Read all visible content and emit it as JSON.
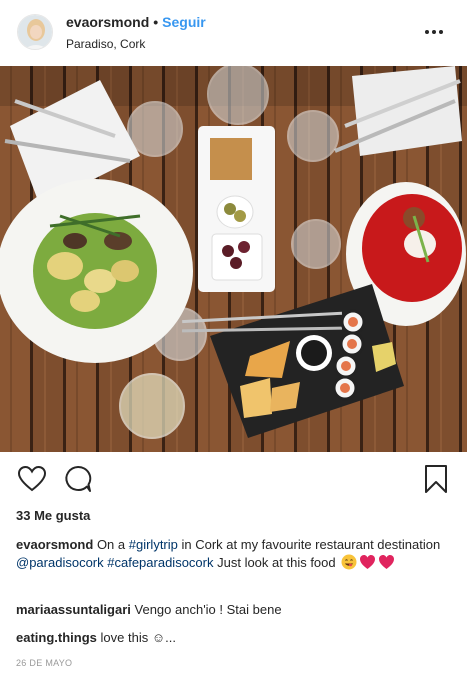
{
  "post": {
    "username": "evaorsmond",
    "separator": "•",
    "follow_label": "Seguir",
    "location": "Paradiso, Cork",
    "more_icon": "ellipsis-icon",
    "likes": "33 Me gusta",
    "date": "26 DE MAYO"
  },
  "caption": {
    "username": "evaorsmond",
    "t1": "On a",
    "tag1": "#girlytrip",
    "t2": "in Cork at my favourite restaurant destination",
    "mention": "@paradisocork",
    "tag2": "#cafeparadisocork",
    "t3": "Just look at this food",
    "emojis": [
      "yum-face-emoji",
      "heart-emoji",
      "heart-emoji"
    ]
  },
  "comments": [
    {
      "username": "mariaassuntaligari",
      "text": "Vengo anch'io ! Stai bene"
    },
    {
      "username": "eating.things",
      "text": "love this ☺..."
    }
  ],
  "icons": {
    "like": "heart-outline-icon",
    "comment": "comment-bubble-icon",
    "save": "bookmark-icon"
  },
  "colors": {
    "link_blue": "#3897f0",
    "hashtag": "#003569",
    "table_wood": "#7a4a2b"
  }
}
